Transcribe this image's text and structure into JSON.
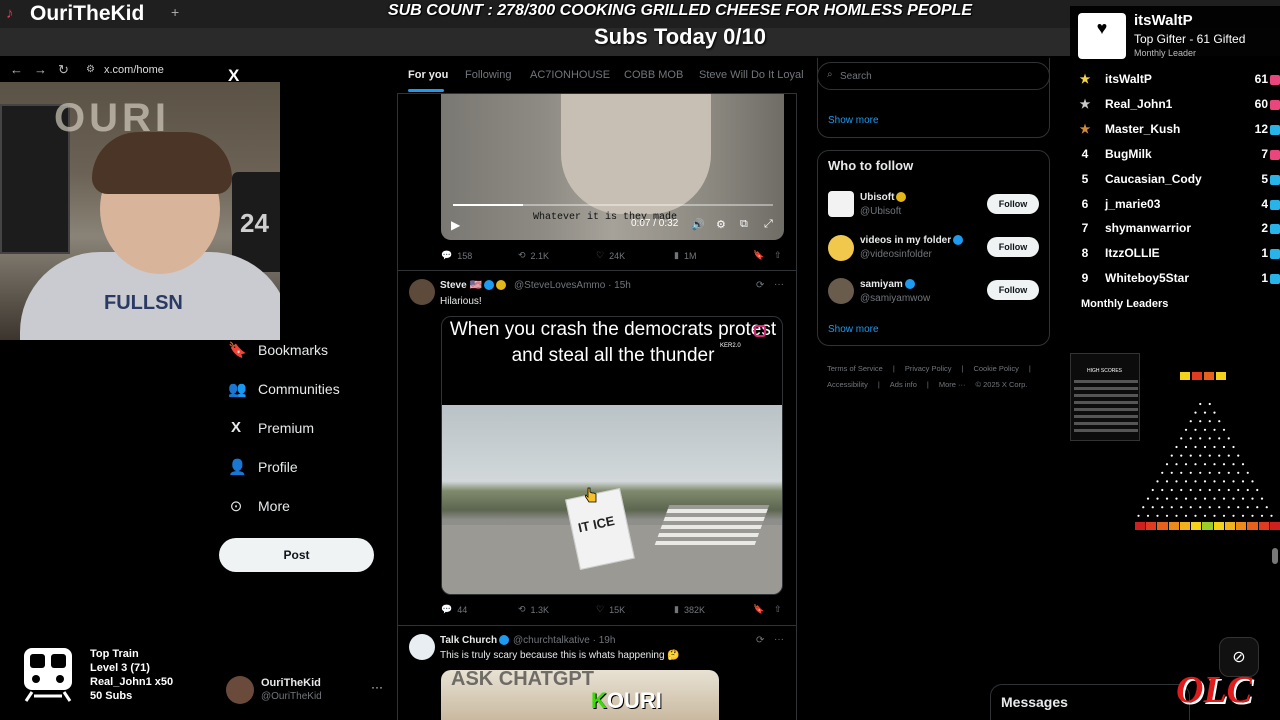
{
  "browser": {
    "tab_title": "OuriTheKid",
    "new_tab": "+",
    "url": "x.com/home"
  },
  "stream_overlay": {
    "sub_goal": "SUB COUNT : 278/300 COOKING GRILLED CHEESE FOR HOMLESS PEOPLE",
    "subs_today": "Subs Today  0/10",
    "webcam_hoodie_text": "FULLSN",
    "webcam_sign_text": "OURI",
    "webcam_jersey_text": "24"
  },
  "left_nav": {
    "logo": "X",
    "items": [
      {
        "icon": "bookmark-icon",
        "label": "Bookmarks"
      },
      {
        "icon": "communities-icon",
        "label": "Communities"
      },
      {
        "icon": "x-premium-icon",
        "label": "Premium"
      },
      {
        "icon": "profile-icon",
        "label": "Profile"
      },
      {
        "icon": "more-circle-icon",
        "label": "More"
      }
    ],
    "post_label": "Post",
    "account": {
      "name": "OuriTheKid",
      "handle": "@OuriTheKid",
      "more": "···"
    }
  },
  "train": {
    "line1": "Top Train",
    "line2": "Level 3  (71)",
    "line3": "Real_John1 x50",
    "line4": "50 Subs"
  },
  "feed_tabs": [
    {
      "label": "For you",
      "active": true
    },
    {
      "label": "Following",
      "active": false
    },
    {
      "label": "AC7IONHOUSE",
      "active": false
    },
    {
      "label": "COBB MOB",
      "active": false
    },
    {
      "label": "Steve Will Do It Loyal",
      "active": false
    }
  ],
  "video1": {
    "caption": "Whatever it is they made",
    "time": "0:07 / 0:32",
    "progress": 0.22,
    "actions": {
      "replies": "158",
      "reposts": "2.1K",
      "likes": "24K",
      "views": "1M"
    }
  },
  "tweet2": {
    "name": "Steve",
    "flag": "🇺🇸",
    "handle": "@SteveLovesAmmo · 15h",
    "text": "Hilarious!",
    "meme_text": "When you crash the democrats protest and steal all the thunder",
    "watermark": "KER2.0",
    "sign_text": "IT ICE",
    "actions": {
      "replies": "44",
      "reposts": "1.3K",
      "likes": "15K",
      "views": "382K"
    }
  },
  "tweet3": {
    "name": "Talk Church",
    "handle": "@churchtalkative · 19h",
    "text": "This is truly scary because this is whats happening 🤔",
    "media_text_k": "K",
    "media_text_rest": "OURI",
    "media_text_top": "ASK CHATGPT"
  },
  "right_sidebar": {
    "search_placeholder": "Search",
    "show_more_top": "Show more",
    "who_to_follow_title": "Who to follow",
    "follow_suggestions": [
      {
        "name": "Ubisoft",
        "handle": "@Ubisoft",
        "button": "Follow",
        "badge": "gold"
      },
      {
        "name": "videos in my folder",
        "handle": "@videosinfolder",
        "button": "Follow",
        "badge": "blue"
      },
      {
        "name": "samiyam",
        "handle": "@samiyamwow",
        "button": "Follow",
        "badge": "blue"
      }
    ],
    "show_more_bottom": "Show more",
    "footer_links": [
      "Terms of Service",
      "|",
      "Privacy Policy",
      "|",
      "Cookie Policy",
      "|",
      "Accessibility",
      "|",
      "Ads info",
      "|",
      "More ···",
      "© 2025 X Corp."
    ]
  },
  "leaderboard": {
    "top_user": "itsWaltP",
    "top_desc": "Top Gifter - 61 Gifted",
    "top_sub": "Monthly Leader",
    "rows": [
      {
        "rank": "★",
        "rank_color": "#f3d34a",
        "name": "itsWaltP",
        "count": "61",
        "box_color": "#e8467c"
      },
      {
        "rank": "★",
        "rank_color": "#c9c9c9",
        "name": "Real_John1",
        "count": "60",
        "box_color": "#e8467c"
      },
      {
        "rank": "★",
        "rank_color": "#d08b3b",
        "name": "Master_Kush",
        "count": "12",
        "box_color": "#28b4e8"
      },
      {
        "rank": "4",
        "rank_color": "#ffffff",
        "name": "BugMilk",
        "count": "7",
        "box_color": "#e8467c"
      },
      {
        "rank": "5",
        "rank_color": "#ffffff",
        "name": "Caucasian_Cody",
        "count": "5",
        "box_color": "#28b4e8"
      },
      {
        "rank": "6",
        "rank_color": "#ffffff",
        "name": "j_marie03",
        "count": "4",
        "box_color": "#28b4e8"
      },
      {
        "rank": "7",
        "rank_color": "#ffffff",
        "name": "shymanwarrior",
        "count": "2",
        "box_color": "#28b4e8"
      },
      {
        "rank": "8",
        "rank_color": "#ffffff",
        "name": "ItzzOLLIE",
        "count": "1",
        "box_color": "#28b4e8"
      },
      {
        "rank": "9",
        "rank_color": "#ffffff",
        "name": "Whiteboy5Star",
        "count": "1",
        "box_color": "#28b4e8"
      }
    ],
    "footer": "Monthly Leaders"
  },
  "plinko": {
    "high_scores_title": "HIGH SCORES",
    "bucket_colors": [
      "#d01f1f",
      "#e03a1f",
      "#e8611c",
      "#ee8a1a",
      "#f2b21a",
      "#f4d21a",
      "#9ccc2a",
      "#f4d21a",
      "#f2b21a",
      "#ee8a1a",
      "#e8611c",
      "#e03a1f",
      "#d01f1f"
    ]
  },
  "messages": {
    "label": "Messages"
  },
  "branding": {
    "olc": "OLC"
  }
}
